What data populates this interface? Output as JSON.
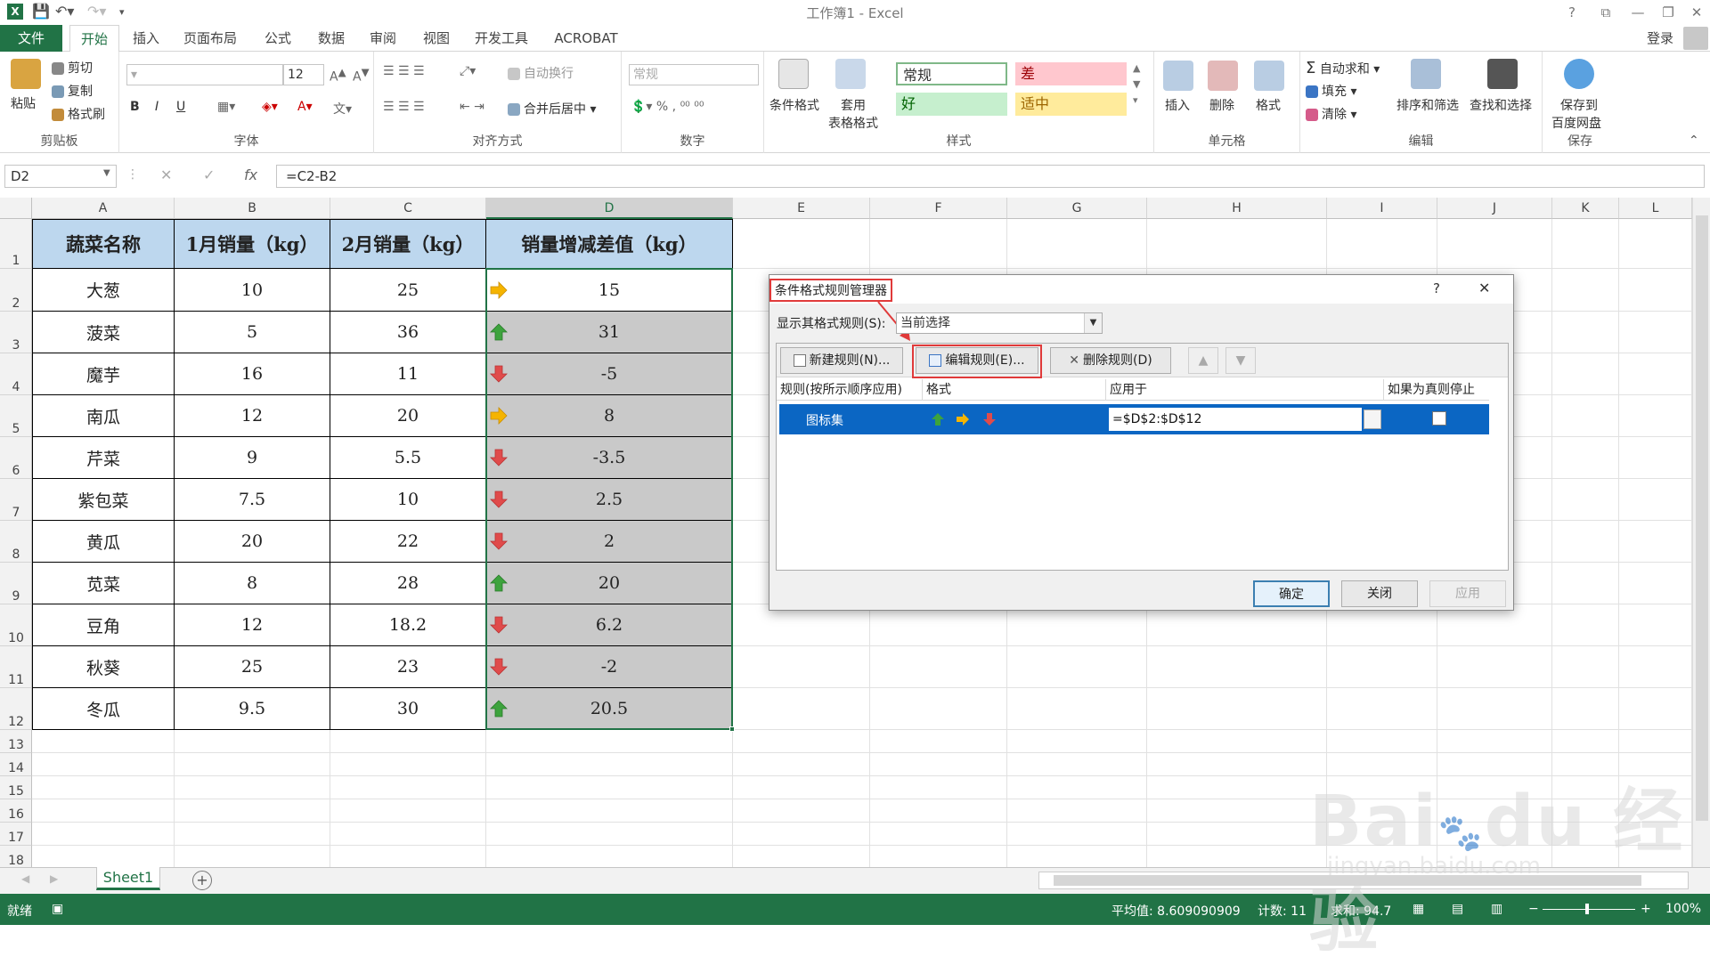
{
  "titlebar": {
    "title": "工作簿1 - Excel",
    "help": "?",
    "qat_save_icon": "save-icon",
    "qat_undo_icon": "undo-icon",
    "qat_redo_icon": "redo-icon"
  },
  "tabs": [
    "文件",
    "开始",
    "插入",
    "页面布局",
    "公式",
    "数据",
    "审阅",
    "视图",
    "开发工具",
    "ACROBAT"
  ],
  "login": "登录",
  "ribbon": {
    "clipboard": {
      "paste": "粘贴",
      "cut": "剪切",
      "copy": "复制",
      "format_painter": "格式刷",
      "label": "剪贴板"
    },
    "font": {
      "size": "12",
      "bold": "B",
      "italic": "I",
      "underline": "U",
      "label": "字体"
    },
    "align": {
      "wrap": "自动换行",
      "merge": "合并后居中",
      "label": "对齐方式"
    },
    "number": {
      "format": "常规",
      "label": "数字"
    },
    "styles": {
      "cond": "条件格式",
      "table": "套用",
      "table2": "表格格式",
      "normal": "常规",
      "bad": "差",
      "good": "好",
      "neutral": "适中",
      "label": "样式"
    },
    "cells": {
      "insert": "插入",
      "delete": "删除",
      "format": "格式",
      "label": "单元格"
    },
    "editing": {
      "autosum": "自动求和",
      "fill": "填充",
      "clear": "清除",
      "sort": "排序和筛选",
      "find": "查找和选择",
      "label": "编辑"
    },
    "save": {
      "line1": "保存到",
      "line2": "百度网盘",
      "label": "保存"
    }
  },
  "formula_bar": {
    "name_box": "D2",
    "formula": "=C2-B2",
    "fx": "fx"
  },
  "columns": [
    "A",
    "B",
    "C",
    "D",
    "E",
    "F",
    "G",
    "H",
    "I",
    "J",
    "K",
    "L"
  ],
  "rows": [
    "1",
    "2",
    "3",
    "4",
    "5",
    "6",
    "7",
    "8",
    "9",
    "10",
    "11",
    "12",
    "13",
    "14",
    "15",
    "16",
    "17",
    "18"
  ],
  "table": {
    "headers": [
      "蔬菜名称",
      "1月销量（kg）",
      "2月销量（kg）",
      "销量增减差值（kg）"
    ],
    "rows": [
      [
        "大葱",
        "10",
        "25",
        "15",
        "right"
      ],
      [
        "菠菜",
        "5",
        "36",
        "31",
        "up"
      ],
      [
        "魔芋",
        "16",
        "11",
        "-5",
        "down"
      ],
      [
        "南瓜",
        "12",
        "20",
        "8",
        "right"
      ],
      [
        "芹菜",
        "9",
        "5.5",
        "-3.5",
        "down"
      ],
      [
        "紫包菜",
        "7.5",
        "10",
        "2.5",
        "down"
      ],
      [
        "黄瓜",
        "20",
        "22",
        "2",
        "down"
      ],
      [
        "苋菜",
        "8",
        "28",
        "20",
        "up"
      ],
      [
        "豆角",
        "12",
        "18.2",
        "6.2",
        "down"
      ],
      [
        "秋葵",
        "25",
        "23",
        "-2",
        "down"
      ],
      [
        "冬瓜",
        "9.5",
        "30",
        "20.5",
        "up"
      ]
    ]
  },
  "dialog": {
    "title": "条件格式规则管理器",
    "help": "?",
    "close": "✕",
    "show_rules_label": "显示其格式规则(S):",
    "show_rules_value": "当前选择",
    "new_rule": "新建规则(N)...",
    "edit_rule": "编辑规则(E)...",
    "delete_rule": "删除规则(D)",
    "col_rule": "规则(按所示顺序应用)",
    "col_format": "格式",
    "col_applies": "应用于",
    "col_stop": "如果为真则停止",
    "rule_name": "图标集",
    "applies_to": "=$D$2:$D$12",
    "ok": "确定",
    "close_btn": "关闭",
    "apply": "应用"
  },
  "sheet_tab": "Sheet1",
  "status": {
    "ready": "就绪",
    "average": "平均值: 8.609090909",
    "count": "计数: 11",
    "sum": "求和: 94.7",
    "zoom": "100%"
  },
  "colors": {
    "excel_green": "#217346",
    "header_blue": "#bdd7ee",
    "selection_blue": "#0b66c3",
    "highlight_red": "#e03a3a"
  }
}
